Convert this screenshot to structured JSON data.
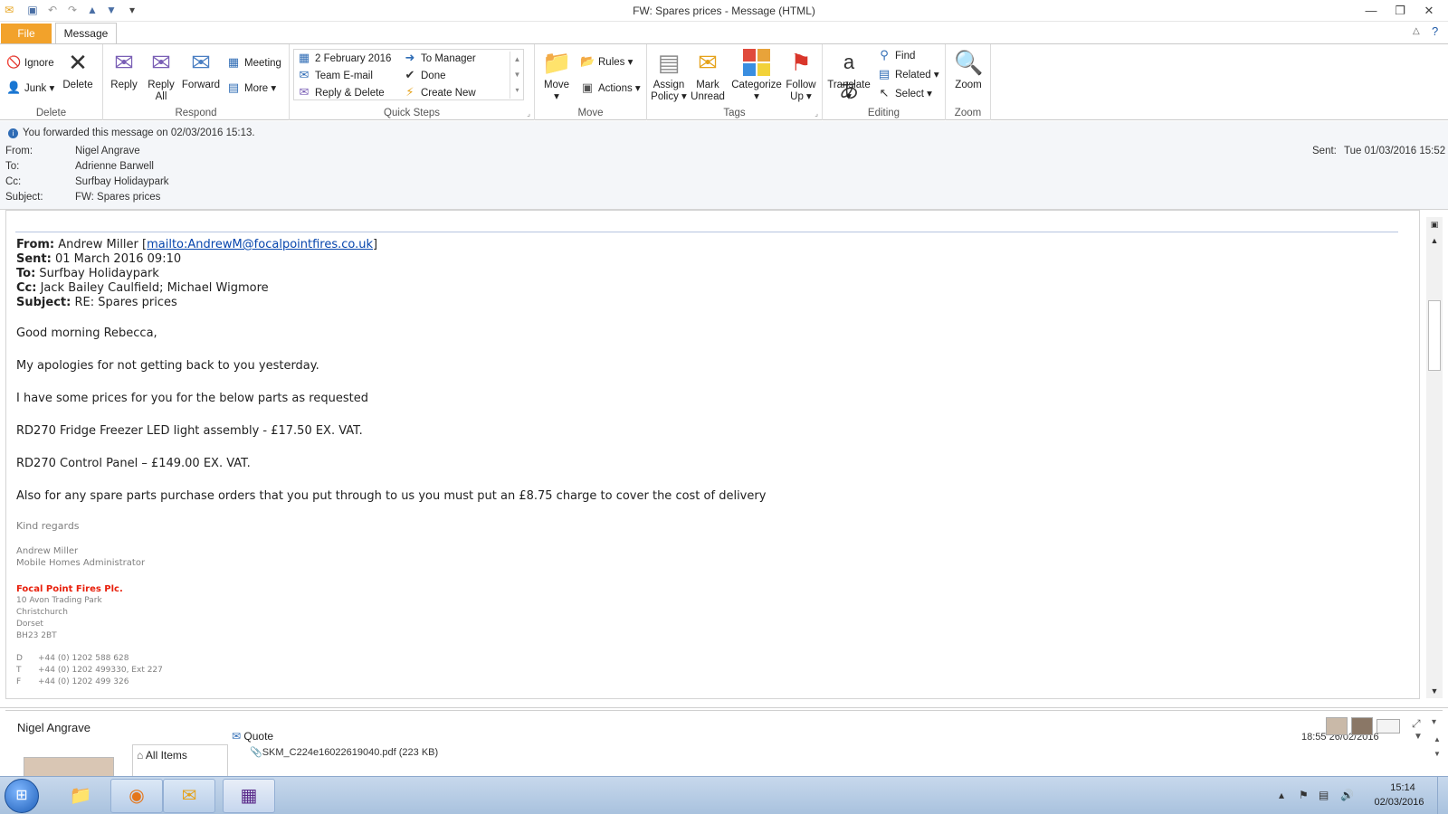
{
  "window": {
    "title": "FW: Spares prices  -  Message (HTML)"
  },
  "tabs": {
    "file": "File",
    "message": "Message"
  },
  "ribbon": {
    "delete_group": {
      "label": "Delete",
      "ignore": "Ignore",
      "junk": "Junk",
      "delete": "Delete"
    },
    "respond_group": {
      "label": "Respond",
      "reply": "Reply",
      "reply_all_1": "Reply",
      "reply_all_2": "All",
      "forward": "Forward",
      "meeting": "Meeting",
      "more": "More"
    },
    "quicksteps_group": {
      "label": "Quick Steps",
      "items": [
        "2 February 2016",
        "To Manager",
        "Team E-mail",
        "Done",
        "Reply & Delete",
        "Create New"
      ]
    },
    "move_group": {
      "label": "Move",
      "move": "Move",
      "rules": "Rules",
      "actions": "Actions"
    },
    "tags_group": {
      "label": "Tags",
      "assign_1": "Assign",
      "assign_2": "Policy",
      "mark_1": "Mark",
      "mark_2": "Unread",
      "categorize": "Categorize",
      "follow_1": "Follow",
      "follow_2": "Up"
    },
    "editing_group": {
      "label": "Editing",
      "translate": "Translate",
      "find": "Find",
      "related": "Related",
      "select": "Select"
    },
    "zoom_group": {
      "label": "Zoom",
      "zoom": "Zoom"
    }
  },
  "header": {
    "info": "You forwarded this message on 02/03/2016 15:13.",
    "from_label": "From:",
    "from": "Nigel Angrave",
    "to_label": "To:",
    "to": "Adrienne Barwell",
    "cc_label": "Cc:",
    "cc": "Surfbay Holidaypark",
    "subject_label": "Subject:",
    "subject": "FW: Spares prices",
    "sent_label": "Sent:",
    "sent": "Tue 01/03/2016 15:52"
  },
  "body": {
    "from_label": "From:",
    "from": "Andrew Miller",
    "from_link": "mailto:AndrewM@focalpointfires.co.uk",
    "sent_label": "Sent:",
    "sent": "01 March 2016 09:10",
    "to_label": "To:",
    "to": "Surfbay Holidaypark",
    "cc_label": "Cc:",
    "cc": "Jack Bailey Caulfield; Michael Wigmore",
    "subject_label": "Subject:",
    "subject": "RE: Spares prices",
    "paragraphs": [
      "Good morning Rebecca,",
      "My apologies for not getting back to you yesterday.",
      "I have some prices for you for the below parts as requested",
      "RD270 Fridge Freezer LED light assembly - £17.50 EX. VAT.",
      "RD270 Control Panel – £149.00 EX. VAT.",
      "Also for any spare parts purchase orders that you put through to us you must put an £8.75 charge to cover the cost of delivery"
    ],
    "signature": {
      "regards": "Kind regards",
      "name": "Andrew Miller",
      "role": "Mobile Homes Administrator",
      "company": "Focal Point Fires Plc.",
      "address": [
        "10 Avon Trading Park",
        "Christchurch",
        "Dorset",
        "BH23 2BT"
      ],
      "phones": [
        {
          "k": "D",
          "v": "+44 (0) 1202 588 628"
        },
        {
          "k": "T",
          "v": "+44 (0) 1202 499330, Ext 227"
        },
        {
          "k": "F",
          "v": "+44 (0) 1202 499 326"
        }
      ]
    }
  },
  "people_pane": {
    "name": "Nigel Angrave",
    "all_items": "All Items",
    "item_title": "Quote",
    "attachment": "SKM_C224e16022619040.pdf (223 KB)",
    "item_date": "18:55  26/02/2016"
  },
  "taskbar": {
    "time": "15:14",
    "date": "02/03/2016"
  },
  "colors": {
    "file_tab": "#f2a22b",
    "link": "#0645ad",
    "company": "#e8200c"
  }
}
